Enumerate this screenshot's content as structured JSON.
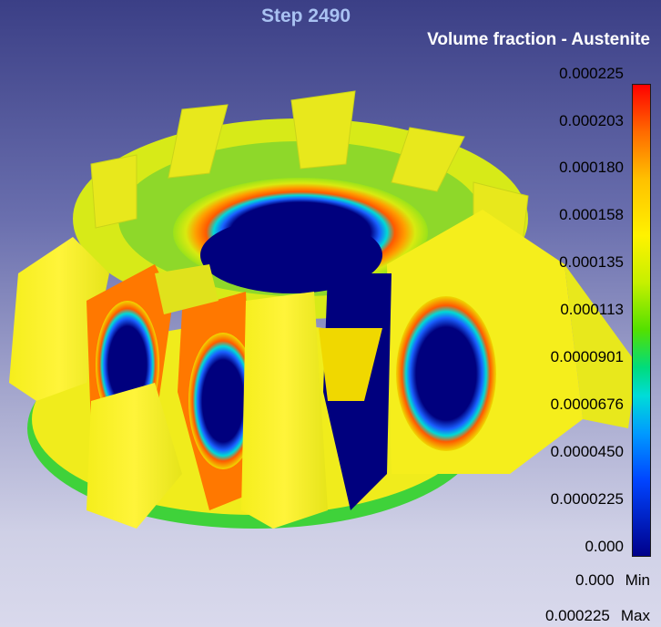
{
  "viewport": {
    "step_label": "Step 2490",
    "legend_title": "Volume fraction - Austenite"
  },
  "legend": {
    "ticks": [
      "0.000225",
      "0.000203",
      "0.000180",
      "0.000158",
      "0.000135",
      "0.000113",
      "0.0000901",
      "0.0000676",
      "0.0000450",
      "0.0000225",
      "0.000"
    ],
    "min_value": "0.000",
    "min_label": "Min",
    "max_value": "0.000225",
    "max_label": "Max",
    "colors": [
      "#ff0000",
      "#ffc000",
      "#fff200",
      "#53e000",
      "#00dcd8",
      "#0044ff",
      "#00008a"
    ]
  }
}
